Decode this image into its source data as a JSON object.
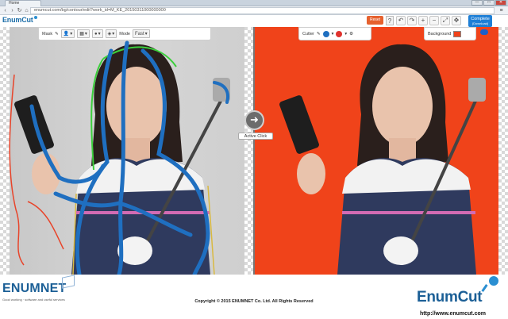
{
  "browser": {
    "tab_title": "Home",
    "url": "enumcut.com/bg/contour/edit?work_id=M_KE_20150311000000000",
    "window_buttons": [
      "—",
      "□",
      "✕"
    ]
  },
  "app": {
    "logo": {
      "enum": "EnumCut",
      "cut": "",
      "pin": ""
    },
    "reset_label": "Reset",
    "help_label": "?",
    "complete_label": "Complete",
    "complete_sub": "(Download)",
    "top_icons": [
      "undo-icon",
      "redo-icon",
      "zoom-in-icon",
      "zoom-out-icon",
      "fit-icon",
      "fullscreen-icon"
    ]
  },
  "mask_toolbar": {
    "mask_label": "Mask",
    "mode_label": "Mode",
    "mode_value": "Fast"
  },
  "cutter_toolbar": {
    "cutter_label": "Cutter",
    "background_label": "Background",
    "background_color": "#f0431a"
  },
  "canvas": {
    "active_click_label": "Active Click",
    "arrow": "➜"
  },
  "footer": {
    "company": "ENUMNET",
    "tagline": "Good working · software and useful services",
    "copyright": "Copyright © 2015 ENUMNET Co. Ltd. All Rights Reserved",
    "brand": "EnumCut",
    "website": "http://www.enumcut.com"
  },
  "colors": {
    "accent": "#1e7fd6",
    "reset": "#e6612e",
    "stroke_foreground": "#1f6fc0",
    "stroke_background": "#e8442a",
    "contour": "#3ccf3c"
  }
}
